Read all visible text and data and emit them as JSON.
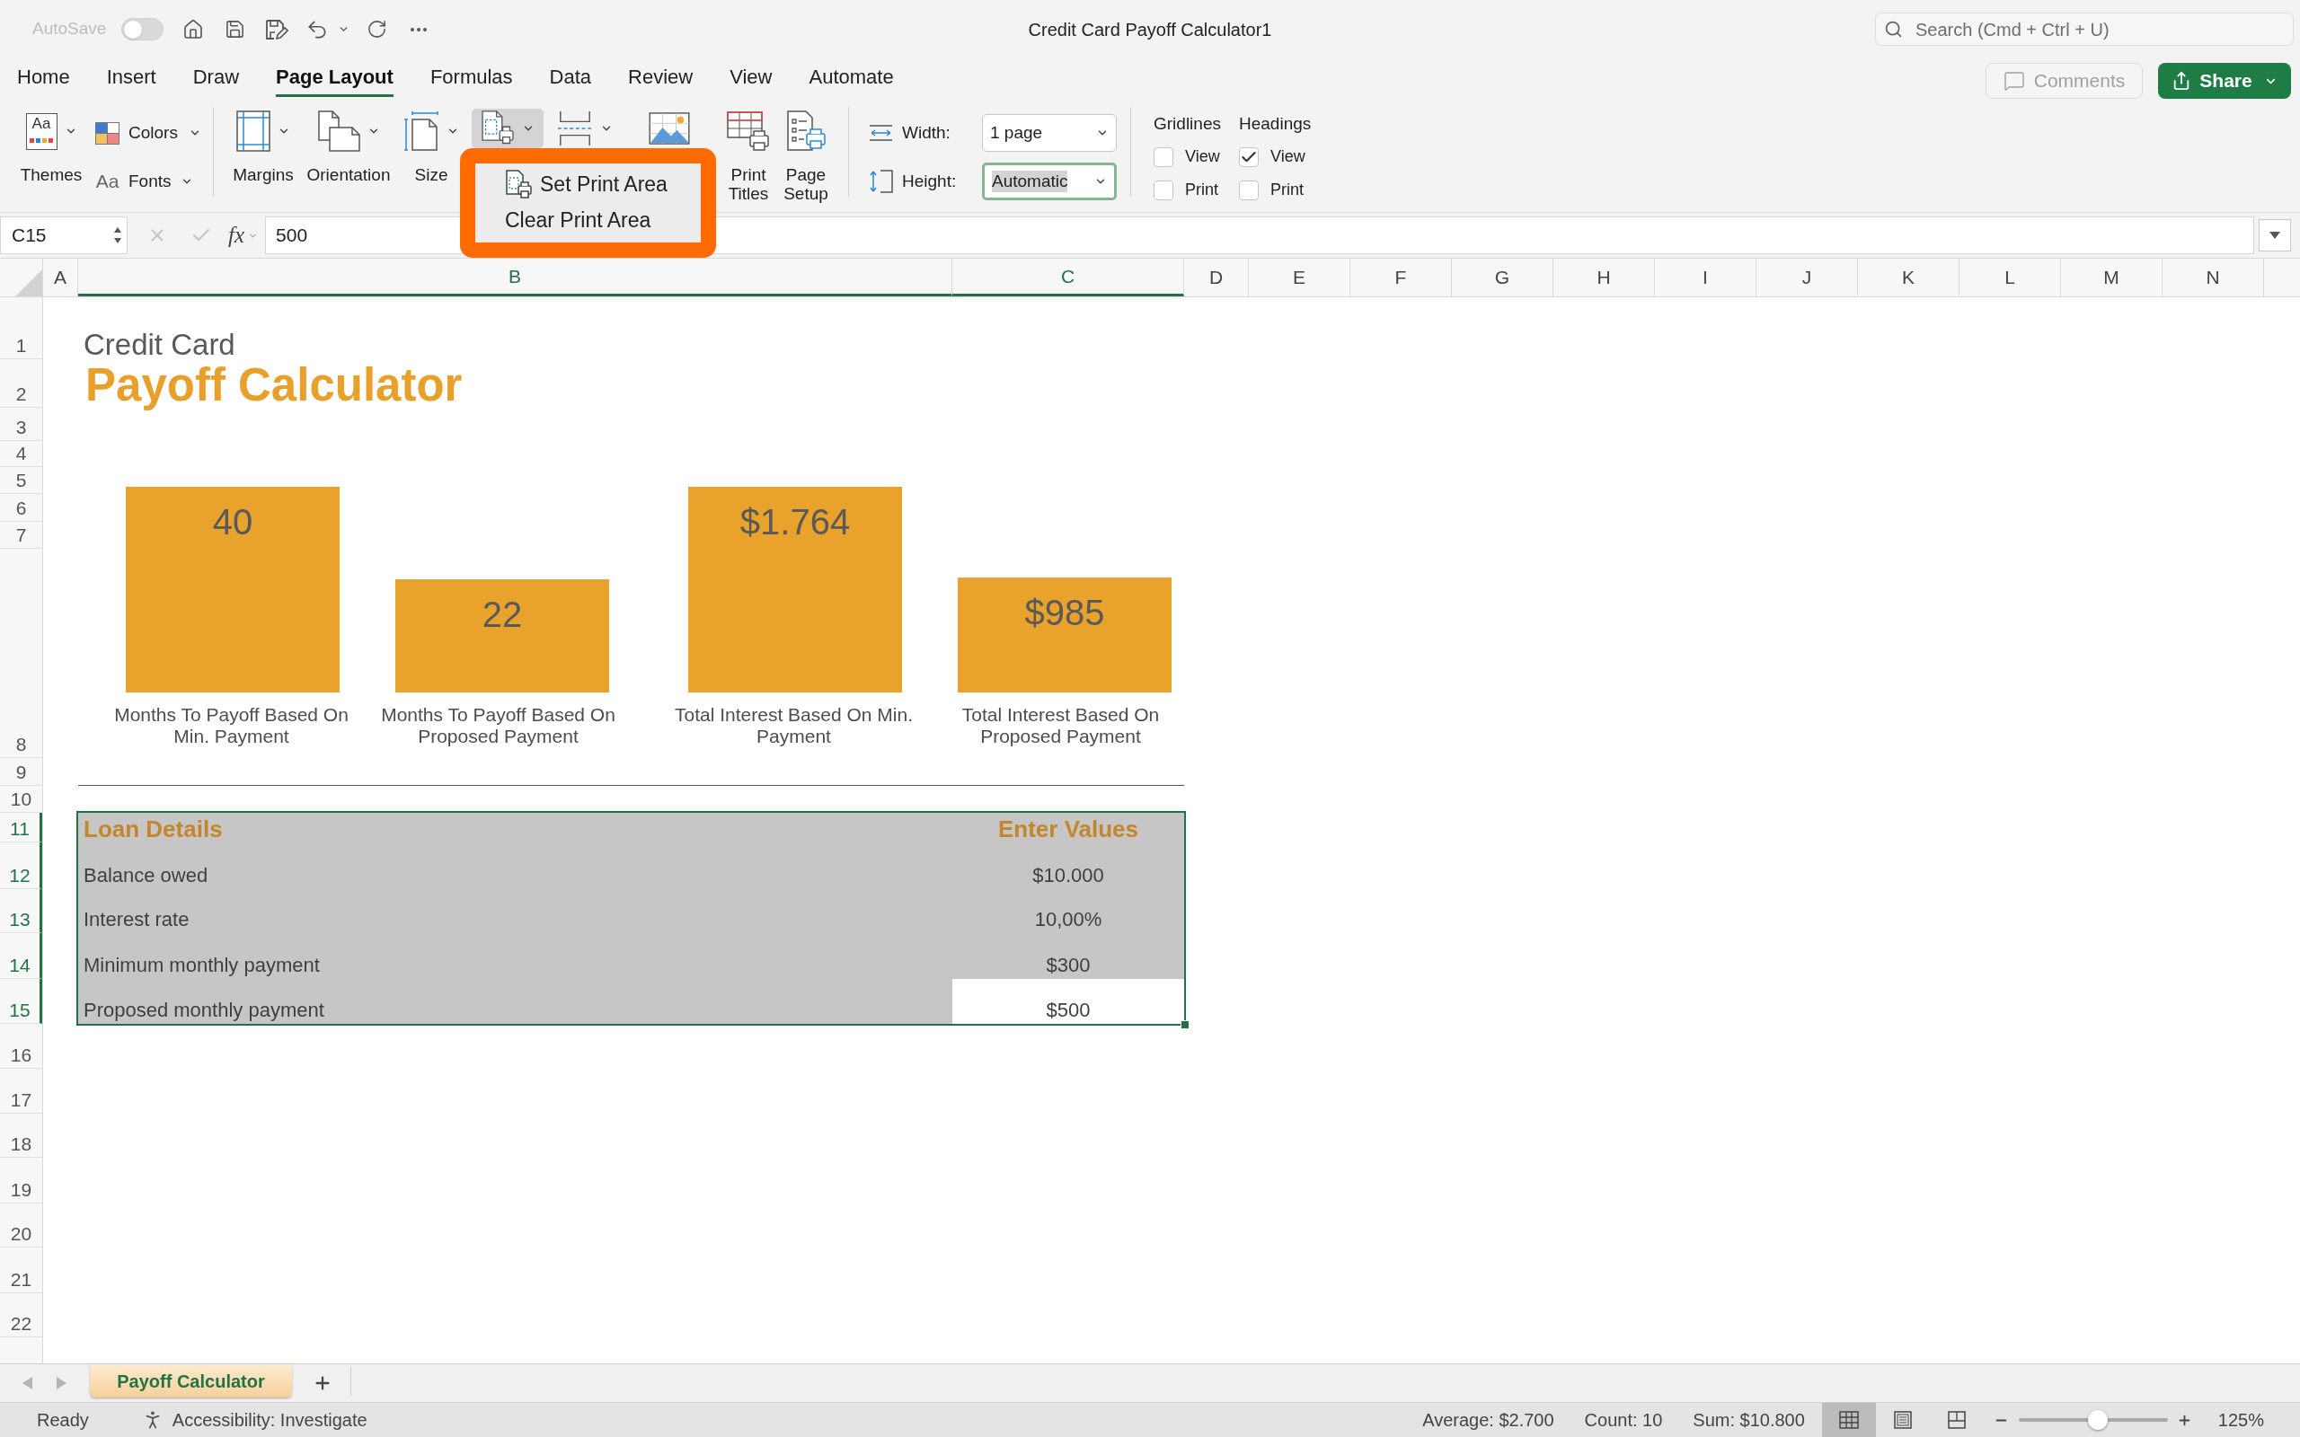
{
  "title_bar": {
    "autosave": {
      "label": "AutoSave",
      "on": false
    },
    "title": "Credit Card Payoff Calculator1",
    "search": {
      "placeholder": "Search (Cmd + Ctrl + U)"
    }
  },
  "menu_tabs": [
    {
      "label": "Home",
      "selected": false
    },
    {
      "label": "Insert",
      "selected": false
    },
    {
      "label": "Draw",
      "selected": false
    },
    {
      "label": "Page Layout",
      "selected": true
    },
    {
      "label": "Formulas",
      "selected": false
    },
    {
      "label": "Data",
      "selected": false
    },
    {
      "label": "Review",
      "selected": false
    },
    {
      "label": "View",
      "selected": false
    },
    {
      "label": "Automate",
      "selected": false
    }
  ],
  "header_actions": {
    "comments": {
      "label": "Comments",
      "disabled": true
    },
    "share": {
      "label": "Share"
    }
  },
  "ribbon": {
    "themes": {
      "icon_text": "Aa",
      "label": "Themes"
    },
    "colors": {
      "label": "Colors"
    },
    "fonts": {
      "icon_text": "Aa",
      "label": "Fonts"
    },
    "page_setup": [
      {
        "kind": "margins",
        "label": "Margins",
        "has_menu": true,
        "expanded": false
      },
      {
        "kind": "orientation",
        "label": "Orientation",
        "has_menu": true,
        "expanded": false
      },
      {
        "kind": "size",
        "label": "Size",
        "has_menu": true,
        "expanded": false
      },
      {
        "kind": "print_area",
        "has_menu": true,
        "expanded": true
      },
      {
        "kind": "breaks",
        "has_menu": true,
        "expanded": false
      },
      {
        "kind": "background",
        "has_menu": false,
        "expanded": false
      },
      {
        "kind": "print_titles",
        "label": "Print Titles",
        "has_menu": false,
        "expanded": false
      },
      {
        "kind": "page_setup",
        "label": "Page Setup",
        "has_menu": false,
        "expanded": false
      }
    ],
    "scale_to_fit": [
      {
        "kind": "width",
        "label": "Width:",
        "value": "1 page",
        "focused": false
      },
      {
        "kind": "height",
        "label": "Height:",
        "value": "Automatic",
        "focused": true
      }
    ],
    "sheet_options": [
      {
        "title": "Gridlines",
        "options": [
          {
            "label": "View",
            "checked": false
          },
          {
            "label": "Print",
            "checked": false
          }
        ]
      },
      {
        "title": "Headings",
        "options": [
          {
            "label": "View",
            "checked": true
          },
          {
            "label": "Print",
            "checked": false
          }
        ]
      }
    ]
  },
  "print_area_menu": {
    "items": [
      {
        "label": "Set Print Area",
        "with_icon": true
      },
      {
        "label": "Clear Print Area",
        "with_icon": false
      }
    ]
  },
  "formula_bar": {
    "name_box": "C15",
    "function_label": "fx",
    "formula": "500"
  },
  "grid": {
    "columns": [
      {
        "label": "A",
        "selected": false
      },
      {
        "label": "B",
        "selected": true
      },
      {
        "label": "C",
        "selected": true
      },
      {
        "label": "D",
        "selected": false
      },
      {
        "label": "E",
        "selected": false
      },
      {
        "label": "F",
        "selected": false
      },
      {
        "label": "G",
        "selected": false
      },
      {
        "label": "H",
        "selected": false
      },
      {
        "label": "I",
        "selected": false
      },
      {
        "label": "J",
        "selected": false
      },
      {
        "label": "K",
        "selected": false
      },
      {
        "label": "L",
        "selected": false
      },
      {
        "label": "M",
        "selected": false
      },
      {
        "label": "N",
        "selected": false
      }
    ],
    "rows": [
      {
        "label": "1",
        "selected": false
      },
      {
        "label": "2",
        "selected": false
      },
      {
        "label": "3",
        "selected": false
      },
      {
        "label": "4",
        "selected": false
      },
      {
        "label": "5",
        "selected": false
      },
      {
        "label": "6",
        "selected": false
      },
      {
        "label": "7",
        "selected": false
      },
      {
        "label": "8",
        "selected": false
      },
      {
        "label": "9",
        "selected": false
      },
      {
        "label": "10",
        "selected": false
      },
      {
        "label": "11",
        "selected": true
      },
      {
        "label": "12",
        "selected": true
      },
      {
        "label": "13",
        "selected": true
      },
      {
        "label": "14",
        "selected": true
      },
      {
        "label": "15",
        "selected": true
      },
      {
        "label": "16",
        "selected": false
      },
      {
        "label": "17",
        "selected": false
      },
      {
        "label": "18",
        "selected": false
      },
      {
        "label": "19",
        "selected": false
      },
      {
        "label": "20",
        "selected": false
      },
      {
        "label": "21",
        "selected": false
      },
      {
        "label": "22",
        "selected": false
      }
    ]
  },
  "sheet": {
    "title": {
      "line_1": "Credit Card",
      "line_2": "Payoff Calculator"
    },
    "charts": [
      {
        "chart_data": {
          "type": "bar",
          "categories": [
            "Months To Payoff Based On Min. Payment",
            "Months To Payoff Based On Proposed Payment"
          ],
          "values": [
            40,
            22
          ],
          "value_labels": [
            "40",
            "22"
          ]
        }
      },
      {
        "chart_data": {
          "type": "bar",
          "categories": [
            "Total Interest Based On Min. Payment",
            "Total Interest Based On Proposed Payment"
          ],
          "values": [
            1764,
            985
          ],
          "value_labels": [
            "$1.764",
            "$985"
          ]
        }
      }
    ],
    "loan_table": {
      "selected": true,
      "header": [
        "Loan Details",
        "Enter Values"
      ],
      "rows": [
        {
          "label": "Balance owed",
          "value": "$10.000",
          "active": false
        },
        {
          "label": "Interest rate",
          "value": "10,00%",
          "active": false
        },
        {
          "label": "Minimum monthly payment",
          "value": "$300",
          "active": false
        },
        {
          "label": "Proposed monthly payment",
          "value": "$500",
          "active": true
        }
      ]
    }
  },
  "sheet_tabs": [
    {
      "label": "Payoff Calculator",
      "selected": true
    }
  ],
  "status_bar": {
    "status": "Ready",
    "accessibility": "Accessibility: Investigate",
    "stats": [
      "Average: $2.700",
      "Count: 10",
      "Sum: $10.800"
    ],
    "views": [
      {
        "kind": "normal",
        "selected": true
      },
      {
        "kind": "page_layout",
        "selected": false
      },
      {
        "kind": "page_break_preview",
        "selected": false
      }
    ],
    "zoom": {
      "level": 0.53,
      "label": "125%"
    }
  }
}
